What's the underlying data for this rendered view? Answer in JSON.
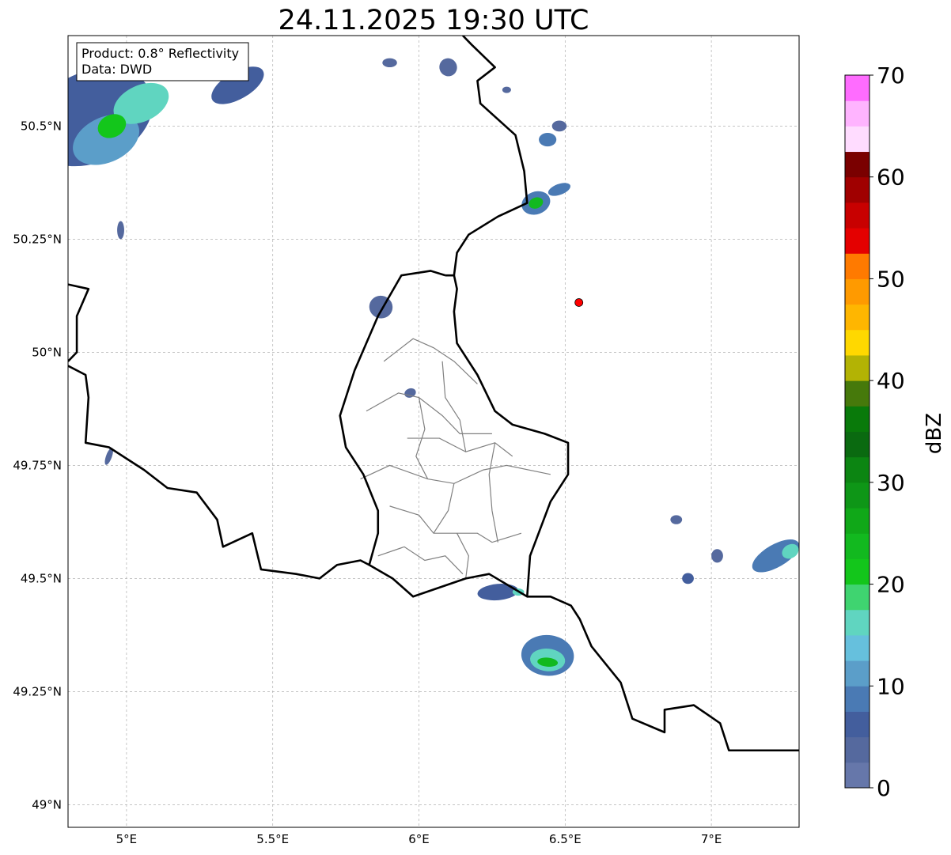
{
  "map": {
    "title": "24.11.2025 19:30 UTC",
    "info": {
      "product": "Product: 0.8° Reflectivity",
      "data": "Data: DWD"
    },
    "extent": {
      "lon_min": 4.8,
      "lon_max": 7.3,
      "lat_min": 48.95,
      "lat_max": 50.7
    },
    "lon_ticks": [
      {
        "value": 5.0,
        "label": "5°E"
      },
      {
        "value": 5.5,
        "label": "5.5°E"
      },
      {
        "value": 6.0,
        "label": "6°E"
      },
      {
        "value": 6.5,
        "label": "6.5°E"
      },
      {
        "value": 7.0,
        "label": "7°E"
      }
    ],
    "lat_ticks": [
      {
        "value": 50.5,
        "label": "50.5°N"
      },
      {
        "value": 50.25,
        "label": "50.25°N"
      },
      {
        "value": 50.0,
        "label": "50°N"
      },
      {
        "value": 49.75,
        "label": "49.75°N"
      },
      {
        "value": 49.5,
        "label": "49.5°N"
      },
      {
        "value": 49.25,
        "label": "49.25°N"
      },
      {
        "value": 49.0,
        "label": "49°N"
      }
    ],
    "radar_site": {
      "lon": 6.547,
      "lat": 50.11,
      "color": "#ff0000"
    },
    "echoes": [
      {
        "lon": 4.88,
        "lat": 50.52,
        "dlon": 0.22,
        "dlat": 0.1,
        "level": 2,
        "rot": -25
      },
      {
        "lon": 4.93,
        "lat": 50.47,
        "dlon": 0.12,
        "dlat": 0.05,
        "level": 4,
        "rot": -25
      },
      {
        "lon": 5.05,
        "lat": 50.55,
        "dlon": 0.1,
        "dlat": 0.04,
        "level": 6,
        "rot": -25
      },
      {
        "lon": 4.95,
        "lat": 50.5,
        "dlon": 0.05,
        "dlat": 0.025,
        "level": 8,
        "rot": -25
      },
      {
        "lon": 5.38,
        "lat": 50.59,
        "dlon": 0.1,
        "dlat": 0.03,
        "level": 2,
        "rot": -30
      },
      {
        "lon": 4.98,
        "lat": 50.27,
        "dlon": 0.012,
        "dlat": 0.02,
        "level": 1,
        "rot": 0
      },
      {
        "lon": 5.87,
        "lat": 50.1,
        "dlon": 0.04,
        "dlat": 0.025,
        "level": 1,
        "rot": 20
      },
      {
        "lon": 5.9,
        "lat": 50.64,
        "dlon": 0.025,
        "dlat": 0.01,
        "level": 1,
        "rot": 0
      },
      {
        "lon": 6.1,
        "lat": 50.63,
        "dlon": 0.03,
        "dlat": 0.02,
        "level": 1,
        "rot": -30
      },
      {
        "lon": 6.4,
        "lat": 50.33,
        "dlon": 0.05,
        "dlat": 0.025,
        "level": 3,
        "rot": -20
      },
      {
        "lon": 6.4,
        "lat": 50.33,
        "dlon": 0.025,
        "dlat": 0.012,
        "level": 9,
        "rot": -20
      },
      {
        "lon": 6.48,
        "lat": 50.36,
        "dlon": 0.04,
        "dlat": 0.012,
        "level": 3,
        "rot": -20
      },
      {
        "lon": 6.44,
        "lat": 50.47,
        "dlon": 0.03,
        "dlat": 0.015,
        "level": 3,
        "rot": 0
      },
      {
        "lon": 6.48,
        "lat": 50.5,
        "dlon": 0.025,
        "dlat": 0.012,
        "level": 1,
        "rot": 0
      },
      {
        "lon": 6.3,
        "lat": 50.58,
        "dlon": 0.015,
        "dlat": 0.007,
        "level": 1,
        "rot": 0
      },
      {
        "lon": 5.97,
        "lat": 49.91,
        "dlon": 0.02,
        "dlat": 0.01,
        "level": 1,
        "rot": -20
      },
      {
        "lon": 6.27,
        "lat": 49.47,
        "dlon": 0.07,
        "dlat": 0.018,
        "level": 2,
        "rot": -5
      },
      {
        "lon": 6.34,
        "lat": 49.47,
        "dlon": 0.02,
        "dlat": 0.008,
        "level": 6,
        "rot": 0
      },
      {
        "lon": 6.44,
        "lat": 49.33,
        "dlon": 0.09,
        "dlat": 0.045,
        "level": 3,
        "rot": 5
      },
      {
        "lon": 6.44,
        "lat": 49.32,
        "dlon": 0.06,
        "dlat": 0.025,
        "level": 6,
        "rot": 5
      },
      {
        "lon": 6.44,
        "lat": 49.315,
        "dlon": 0.035,
        "dlat": 0.01,
        "level": 9,
        "rot": 5
      },
      {
        "lon": 7.22,
        "lat": 49.55,
        "dlon": 0.09,
        "dlat": 0.025,
        "level": 3,
        "rot": -30
      },
      {
        "lon": 7.27,
        "lat": 49.56,
        "dlon": 0.03,
        "dlat": 0.015,
        "level": 6,
        "rot": -30
      },
      {
        "lon": 6.92,
        "lat": 49.5,
        "dlon": 0.02,
        "dlat": 0.012,
        "level": 2,
        "rot": 0
      },
      {
        "lon": 7.02,
        "lat": 49.55,
        "dlon": 0.02,
        "dlat": 0.015,
        "level": 1,
        "rot": 0
      },
      {
        "lon": 6.88,
        "lat": 49.63,
        "dlon": 0.02,
        "dlat": 0.01,
        "level": 1,
        "rot": 0
      },
      {
        "lon": 4.94,
        "lat": 49.77,
        "dlon": 0.01,
        "dlat": 0.02,
        "level": 1,
        "rot": 20
      }
    ],
    "colorbar": {
      "label": "dBZ",
      "min": 0,
      "max": 70,
      "step": 2.5,
      "ticks": [
        "0",
        "10",
        "20",
        "30",
        "40",
        "50",
        "60",
        "70"
      ],
      "colors": [
        "#6677aa",
        "#55699e",
        "#435e9d",
        "#4a7ab4",
        "#5b9ec9",
        "#66c0dd",
        "#60d5c0",
        "#3fd470",
        "#13c61b",
        "#12b91f",
        "#10a818",
        "#0e9617",
        "#0c8512",
        "#0a6a10",
        "#097a0a",
        "#46790b",
        "#b3b304",
        "#ffd800",
        "#ffb600",
        "#ff9a00",
        "#ff7a00",
        "#e40000",
        "#c80000",
        "#a00000",
        "#7a0000",
        "#ffdcff",
        "#ffb4ff",
        "#ff6cff"
      ]
    },
    "borders": {
      "luxembourg": [
        [
          6.09,
          50.17
        ],
        [
          6.12,
          50.17
        ],
        [
          6.13,
          50.14
        ],
        [
          6.12,
          50.09
        ],
        [
          6.13,
          50.02
        ],
        [
          6.2,
          49.95
        ],
        [
          6.26,
          49.87
        ],
        [
          6.32,
          49.84
        ],
        [
          6.43,
          49.82
        ],
        [
          6.51,
          49.8
        ],
        [
          6.51,
          49.73
        ],
        [
          6.45,
          49.67
        ],
        [
          6.38,
          49.55
        ],
        [
          6.37,
          49.46
        ],
        [
          6.24,
          49.51
        ],
        [
          6.16,
          49.5
        ],
        [
          5.98,
          49.46
        ],
        [
          5.91,
          49.5
        ],
        [
          5.83,
          49.53
        ],
        [
          5.86,
          49.6
        ],
        [
          5.86,
          49.65
        ],
        [
          5.81,
          49.73
        ],
        [
          5.75,
          49.79
        ],
        [
          5.73,
          49.86
        ],
        [
          5.78,
          49.96
        ],
        [
          5.86,
          50.08
        ],
        [
          5.94,
          50.17
        ],
        [
          6.04,
          50.18
        ],
        [
          6.09,
          50.17
        ]
      ],
      "france_belgium": [
        [
          4.8,
          49.97
        ],
        [
          4.86,
          49.95
        ],
        [
          4.87,
          49.9
        ],
        [
          4.86,
          49.8
        ],
        [
          4.94,
          49.79
        ],
        [
          5.06,
          49.74
        ],
        [
          5.14,
          49.7
        ],
        [
          5.24,
          49.69
        ],
        [
          5.31,
          49.63
        ],
        [
          5.33,
          49.57
        ],
        [
          5.43,
          49.6
        ],
        [
          5.46,
          49.52
        ],
        [
          5.58,
          49.51
        ],
        [
          5.66,
          49.5
        ],
        [
          5.72,
          49.53
        ],
        [
          5.8,
          49.54
        ],
        [
          5.83,
          49.53
        ]
      ],
      "belgium_germany": [
        [
          6.12,
          50.17
        ],
        [
          6.13,
          50.22
        ],
        [
          6.17,
          50.26
        ],
        [
          6.27,
          50.3
        ],
        [
          6.37,
          50.33
        ],
        [
          6.36,
          50.4
        ],
        [
          6.33,
          50.48
        ],
        [
          6.21,
          50.55
        ],
        [
          6.2,
          50.6
        ],
        [
          6.26,
          50.63
        ],
        [
          6.18,
          50.68
        ],
        [
          6.15,
          50.7
        ]
      ],
      "france_germany": [
        [
          6.37,
          49.46
        ],
        [
          6.45,
          49.46
        ],
        [
          6.52,
          49.44
        ],
        [
          6.55,
          49.41
        ],
        [
          6.59,
          49.35
        ],
        [
          6.69,
          49.27
        ],
        [
          6.73,
          49.19
        ],
        [
          6.84,
          49.16
        ],
        [
          6.84,
          49.21
        ],
        [
          6.94,
          49.22
        ],
        [
          7.03,
          49.18
        ],
        [
          7.06,
          49.12
        ],
        [
          7.16,
          49.12
        ],
        [
          7.27,
          49.12
        ],
        [
          7.3,
          49.12
        ]
      ],
      "france_belgium_west": [
        [
          4.8,
          50.15
        ],
        [
          4.87,
          50.14
        ],
        [
          4.83,
          50.08
        ],
        [
          4.83,
          50.0
        ],
        [
          4.8,
          49.98
        ]
      ]
    },
    "districts": [
      [
        [
          5.88,
          49.98
        ],
        [
          5.98,
          50.03
        ],
        [
          6.05,
          50.01
        ],
        [
          6.12,
          49.98
        ],
        [
          6.2,
          49.93
        ]
      ],
      [
        [
          5.82,
          49.87
        ],
        [
          5.93,
          49.91
        ],
        [
          6.0,
          49.9
        ],
        [
          6.08,
          49.86
        ],
        [
          6.14,
          49.82
        ],
        [
          6.25,
          49.82
        ]
      ],
      [
        [
          5.96,
          49.81
        ],
        [
          6.07,
          49.81
        ],
        [
          6.16,
          49.78
        ],
        [
          6.26,
          49.8
        ],
        [
          6.32,
          49.77
        ]
      ],
      [
        [
          5.8,
          49.72
        ],
        [
          5.9,
          49.75
        ],
        [
          6.03,
          49.72
        ],
        [
          6.12,
          49.71
        ],
        [
          6.22,
          49.74
        ],
        [
          6.3,
          49.75
        ],
        [
          6.45,
          49.73
        ]
      ],
      [
        [
          5.9,
          49.66
        ],
        [
          6.0,
          49.64
        ],
        [
          6.05,
          49.6
        ],
        [
          6.13,
          49.6
        ],
        [
          6.2,
          49.6
        ],
        [
          6.25,
          49.58
        ],
        [
          6.35,
          49.6
        ]
      ],
      [
        [
          5.86,
          49.55
        ],
        [
          5.95,
          49.57
        ],
        [
          6.02,
          49.54
        ],
        [
          6.09,
          49.55
        ],
        [
          6.15,
          49.51
        ]
      ],
      [
        [
          6.0,
          49.9
        ],
        [
          6.02,
          49.83
        ],
        [
          5.99,
          49.77
        ],
        [
          6.03,
          49.72
        ]
      ],
      [
        [
          6.08,
          49.98
        ],
        [
          6.09,
          49.9
        ],
        [
          6.14,
          49.85
        ],
        [
          6.16,
          49.78
        ]
      ],
      [
        [
          6.12,
          49.71
        ],
        [
          6.1,
          49.65
        ],
        [
          6.05,
          49.6
        ]
      ],
      [
        [
          6.26,
          49.8
        ],
        [
          6.24,
          49.73
        ],
        [
          6.25,
          49.65
        ],
        [
          6.27,
          49.58
        ]
      ],
      [
        [
          6.13,
          49.6
        ],
        [
          6.17,
          49.55
        ],
        [
          6.16,
          49.5
        ]
      ]
    ]
  }
}
